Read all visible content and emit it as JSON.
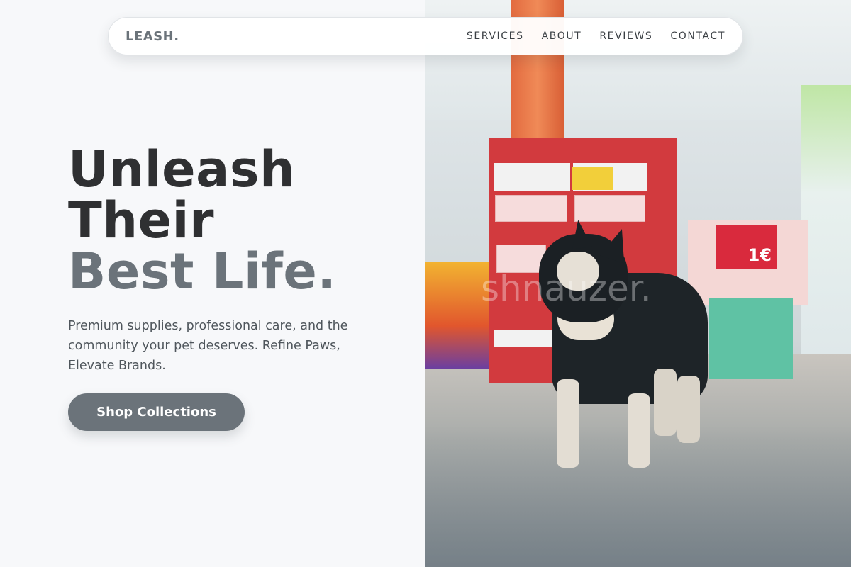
{
  "navbar": {
    "logo": "LEASH.",
    "links": [
      {
        "label": "SERVICES"
      },
      {
        "label": "ABOUT"
      },
      {
        "label": "REVIEWS"
      },
      {
        "label": "CONTACT"
      }
    ]
  },
  "hero": {
    "title_line1": "Unleash",
    "title_line2": "Their",
    "title_line3": "Best Life.",
    "description": "Premium supplies, professional care, and the community your pet deserves. Refine Paws, Elevate Brands.",
    "cta_label": "Shop Collections"
  },
  "photo": {
    "watermark": "shnauzer.",
    "price_sign": "1€"
  },
  "colors": {
    "accent": "#6b737a",
    "heading": "#2f3032",
    "background": "#f7f8fa"
  }
}
